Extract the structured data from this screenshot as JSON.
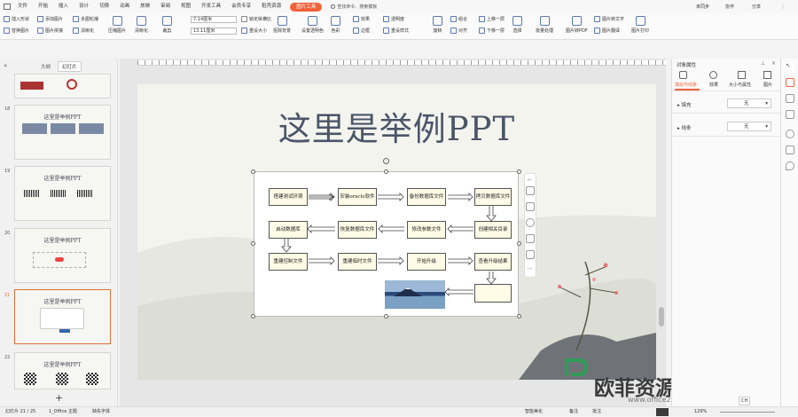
{
  "menubar": {
    "items": [
      "文件",
      "开始",
      "插入",
      "设计",
      "切换",
      "动画",
      "放映",
      "审阅",
      "视图",
      "开发工具",
      "会员专享",
      "稻壳资源",
      "图片工具"
    ],
    "active": "图片工具",
    "search": "查找命令、搜索模板",
    "right": [
      "未同步",
      "协作",
      "分享"
    ]
  },
  "ribbon": {
    "insert_shape": "插入形状",
    "replace_image": "替换图片",
    "add_image": "添加图片",
    "image_split": "图片拼接",
    "multi_image": "多图轮播",
    "compress": "压缩图片",
    "clarify": "清晰化",
    "crop": "裁剪",
    "width": "7.14厘米",
    "height": "13.11厘米",
    "lock_ratio": "锁定纵横比",
    "reset_size": "重设大小",
    "cutout": "抠除背景",
    "set_transparent": "设置透明色",
    "color": "色彩",
    "effect": "效果",
    "border": "边框",
    "transparency": "透明度",
    "reset_style": "重设样式",
    "rotate": "旋转",
    "combine": "组合",
    "align": "对齐",
    "up_layer": "上移一层",
    "down_layer": "下移一层",
    "select": "选择",
    "batch": "批量处理",
    "to_pdf": "图片转PDF",
    "to_text": "图片转文字",
    "translate": "图片翻译",
    "print": "图片打印"
  },
  "leftpane": {
    "tabs": [
      "大纲",
      "幻灯片"
    ],
    "slides": [
      {
        "num": "",
        "title": ""
      },
      {
        "num": "18",
        "title": "这里是举例PPT"
      },
      {
        "num": "19",
        "title": "这里是举例PPT"
      },
      {
        "num": "20",
        "title": "这里是举例PPT"
      },
      {
        "num": "21",
        "title": "这里是举例PPT"
      },
      {
        "num": "22",
        "title": "这里是举例PPT"
      }
    ],
    "add": "+"
  },
  "slide": {
    "title": "这里是举例PPT",
    "flow": [
      "搭建测试环境",
      "安装oracle软件",
      "备份数据库文件",
      "拷贝数据库文件",
      "启动数据库",
      "恢复数据库文件",
      "修改参数文件",
      "创建相关目录",
      "重建控制文件",
      "重建临时文件",
      "开始升级",
      "查看升级结果"
    ]
  },
  "rightpane": {
    "title": "对象属性",
    "tabs": [
      "填充与线条",
      "效果",
      "大小与属性",
      "图片"
    ],
    "fill_label": "填充",
    "fill_value": "无",
    "line_label": "线条",
    "line_value": "无"
  },
  "statusbar": {
    "slide_info": "幻灯片 21 / 25",
    "theme": "1_Office 主题",
    "font_missing": "缺失字体",
    "beautify": "智能美化",
    "notes": "备注",
    "comments": "批注",
    "zoom": "129%",
    "ime": "CH"
  },
  "watermark": {
    "text": "欧菲资源网",
    "url": "www.office26.com"
  },
  "colors": {
    "accent": "#f0623a",
    "title": "#4a5568",
    "selection": "#e0703c"
  }
}
